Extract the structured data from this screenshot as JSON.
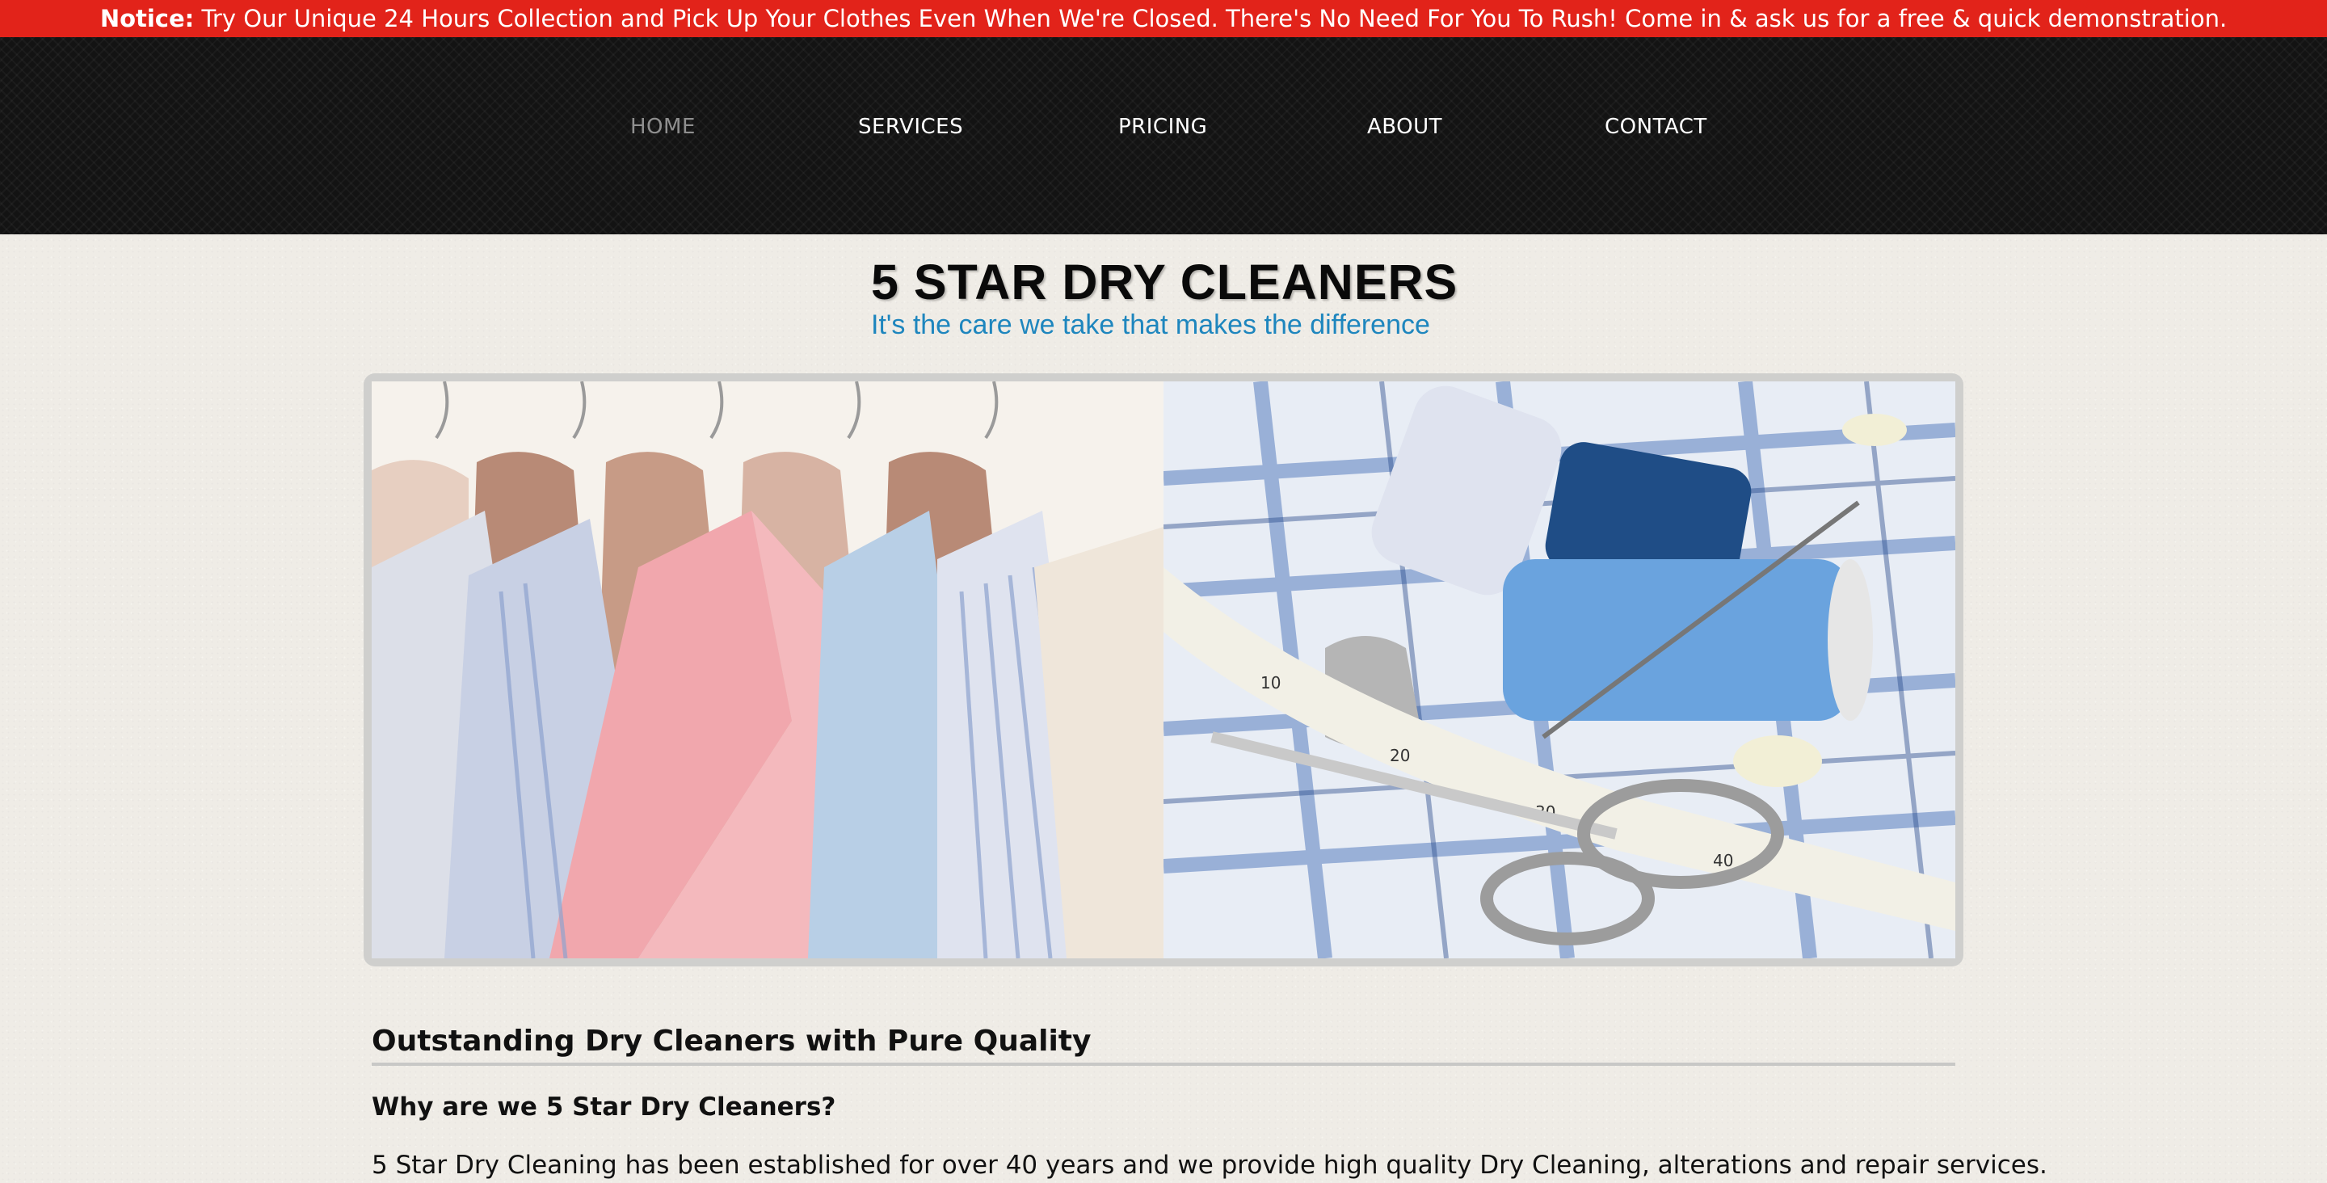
{
  "notice": {
    "label": "Notice:",
    "text": "Try Our Unique 24 Hours Collection and Pick Up Your Clothes Even When We're Closed. There's No Need For You To Rush! Come in & ask us for a free & quick demonstration."
  },
  "nav": {
    "items": [
      {
        "label": "HOME",
        "active": true
      },
      {
        "label": "SERVICES",
        "active": false
      },
      {
        "label": "PRICING",
        "active": false
      },
      {
        "label": "ABOUT",
        "active": false
      },
      {
        "label": "CONTACT",
        "active": false
      }
    ]
  },
  "logo": {
    "title": "5 STAR DRY CLEANERS",
    "tagline": "It's the care we take that makes the difference"
  },
  "slider": {
    "images": [
      {
        "icon": "shirts-on-hangers-image"
      },
      {
        "icon": "sewing-thread-scissors-tape-image"
      }
    ]
  },
  "content": {
    "title": "Outstanding Dry Cleaners with Pure Quality",
    "subheading": "Why are we 5 Star Dry Cleaners?",
    "paragraph": "5 Star Dry Cleaning has been established for over 40 years and we provide high quality Dry Cleaning, alterations and repair services."
  },
  "colors": {
    "notice_bg": "#e2231a",
    "nav_bg": "#131313",
    "nav_active": "#8f8f8f",
    "tagline": "#1e86be",
    "page_bg": "#efece6"
  }
}
